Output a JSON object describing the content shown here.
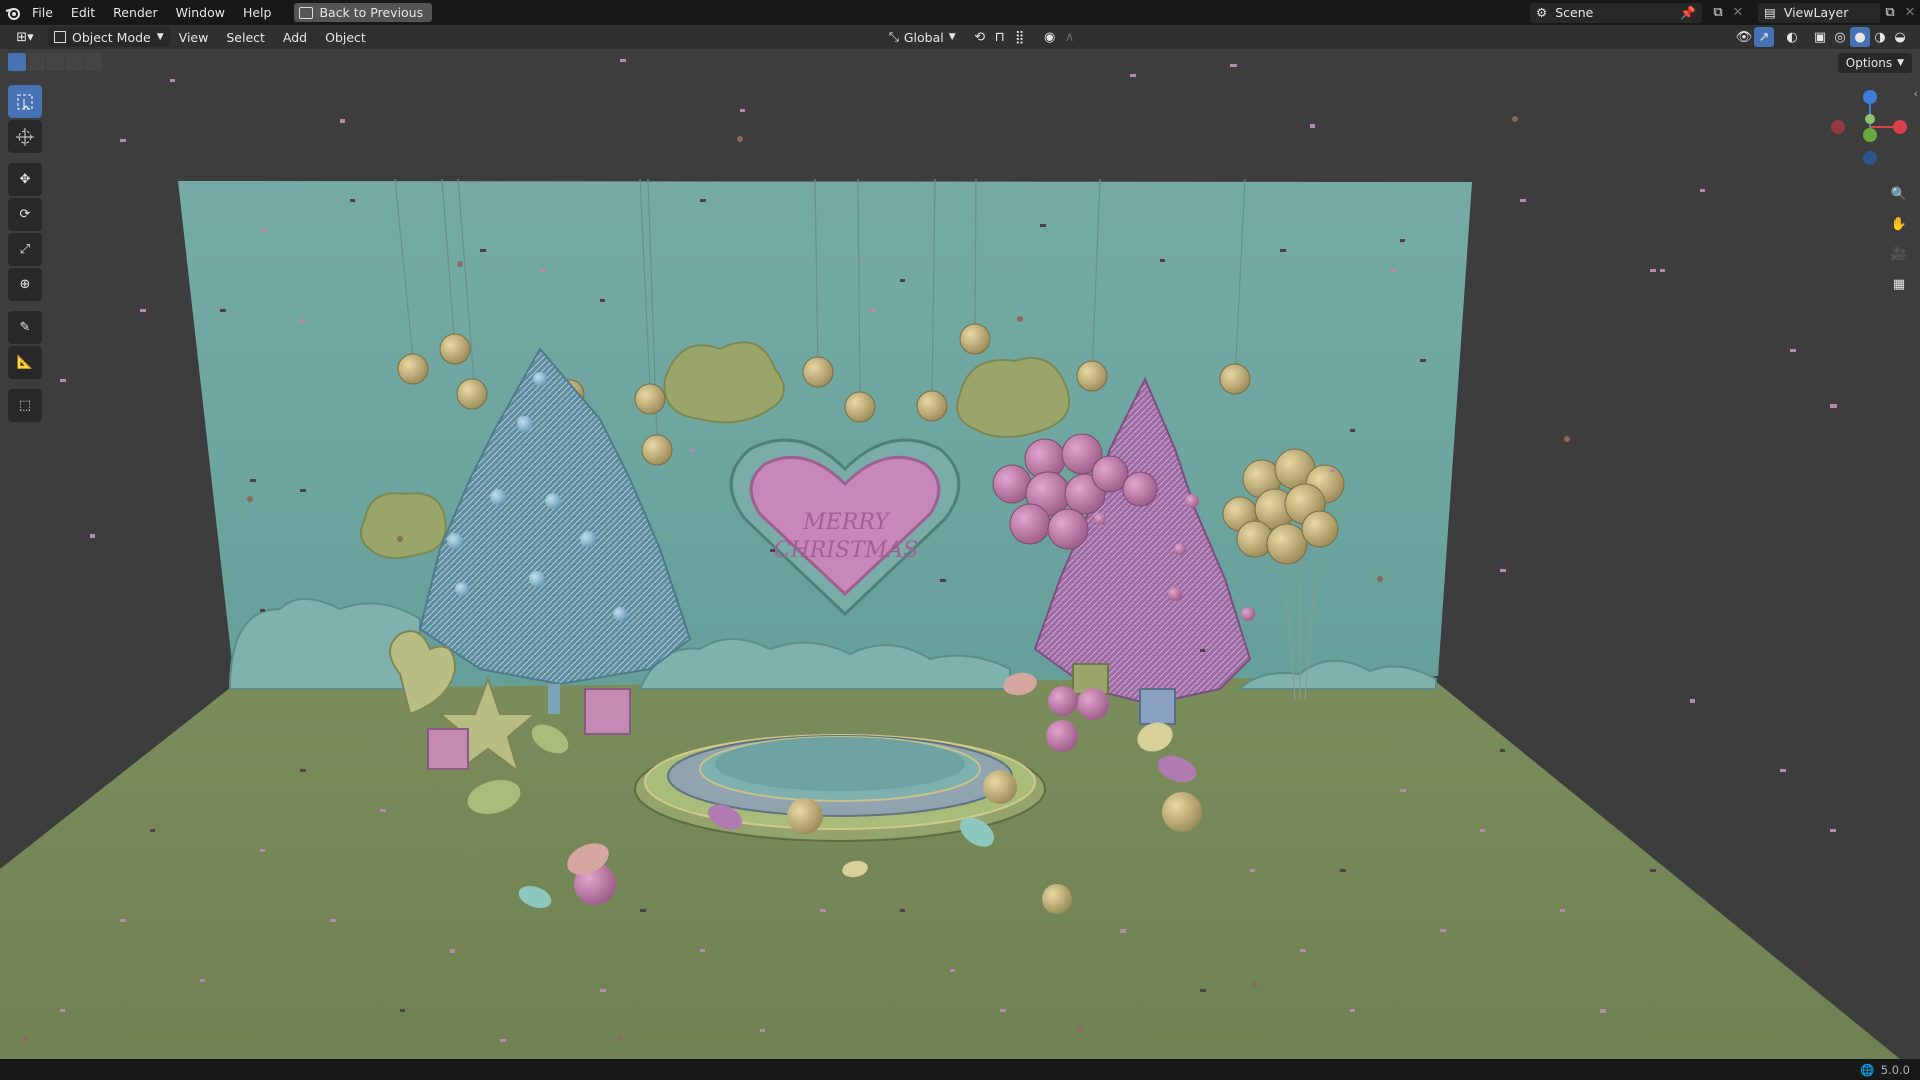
{
  "topbar": {
    "menus": [
      "File",
      "Edit",
      "Render",
      "Window",
      "Help"
    ],
    "back_button": "Back to Previous",
    "scene_label": "Scene",
    "viewlayer_label": "ViewLayer"
  },
  "header": {
    "mode": "Object Mode",
    "menus": [
      "View",
      "Select",
      "Add",
      "Object"
    ],
    "transform_orientation": "Global",
    "options_label": "Options"
  },
  "scene_text": {
    "heart_line1": "MERRY",
    "heart_line2": "CHRISTMAS"
  },
  "status": {
    "version": "5.0.0"
  },
  "colors": {
    "wall": "#6fa6a0",
    "floor": "#788a5a",
    "accent_active": "#4772b3",
    "gizmo_x": "#d9404c",
    "gizmo_y": "#6aa83c",
    "gizmo_z": "#3d7fd8"
  },
  "icons": {
    "tools": [
      "select-box-icon",
      "cursor-icon",
      "move-icon",
      "rotate-icon",
      "scale-icon",
      "transform-icon",
      "annotate-icon",
      "measure-icon",
      "add-cube-icon"
    ],
    "nav": [
      "zoom-icon",
      "pan-hand-icon",
      "camera-icon",
      "grid-icon"
    ]
  }
}
